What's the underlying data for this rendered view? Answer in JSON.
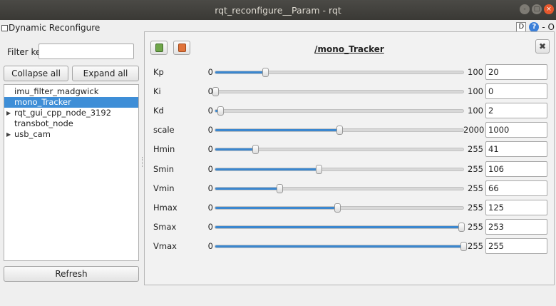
{
  "window": {
    "title": "rqt_reconfigure__Param - rqt",
    "buttons": [
      "-",
      "□",
      "×"
    ]
  },
  "plugin": {
    "title": "Dynamic Reconfigure",
    "right_icons": [
      "D",
      "?"
    ],
    "right_text": "- O"
  },
  "filter": {
    "label": "Filter key:",
    "value": "",
    "placeholder": ""
  },
  "buttons": {
    "collapse_all": "Collapse all",
    "expand_all": "Expand all",
    "refresh": "Refresh"
  },
  "tree": {
    "items": [
      {
        "label": "imu_filter_madgwick",
        "selected": false,
        "expandable": false
      },
      {
        "label": "mono_Tracker",
        "selected": true,
        "expandable": false
      },
      {
        "label": "rqt_gui_cpp_node_3192",
        "selected": false,
        "expandable": true
      },
      {
        "label": "transbot_node",
        "selected": false,
        "expandable": false
      },
      {
        "label": "usb_cam",
        "selected": false,
        "expandable": true
      }
    ]
  },
  "panel": {
    "node_name": "/mono_Tracker",
    "toolbar_icons": [
      "save-icon",
      "load-icon"
    ],
    "close_label": "✖",
    "params": [
      {
        "name": "Kp",
        "min": "0",
        "max": "100",
        "value": "20"
      },
      {
        "name": "Ki",
        "min": "0",
        "max": "100",
        "value": "0"
      },
      {
        "name": "Kd",
        "min": "0",
        "max": "100",
        "value": "2"
      },
      {
        "name": "scale",
        "min": "0",
        "max": "2000",
        "value": "1000"
      },
      {
        "name": "Hmin",
        "min": "0",
        "max": "255",
        "value": "41"
      },
      {
        "name": "Smin",
        "min": "0",
        "max": "255",
        "value": "106"
      },
      {
        "name": "Vmin",
        "min": "0",
        "max": "255",
        "value": "66"
      },
      {
        "name": "Hmax",
        "min": "0",
        "max": "255",
        "value": "125"
      },
      {
        "name": "Smax",
        "min": "0",
        "max": "255",
        "value": "253"
      },
      {
        "name": "Vmax",
        "min": "0",
        "max": "255",
        "value": "255"
      }
    ]
  },
  "colors": {
    "accent": "#3e8ed7",
    "slider_fill": "#3b87cf",
    "titlebar": "#3c3b37",
    "close": "#e7582d"
  }
}
